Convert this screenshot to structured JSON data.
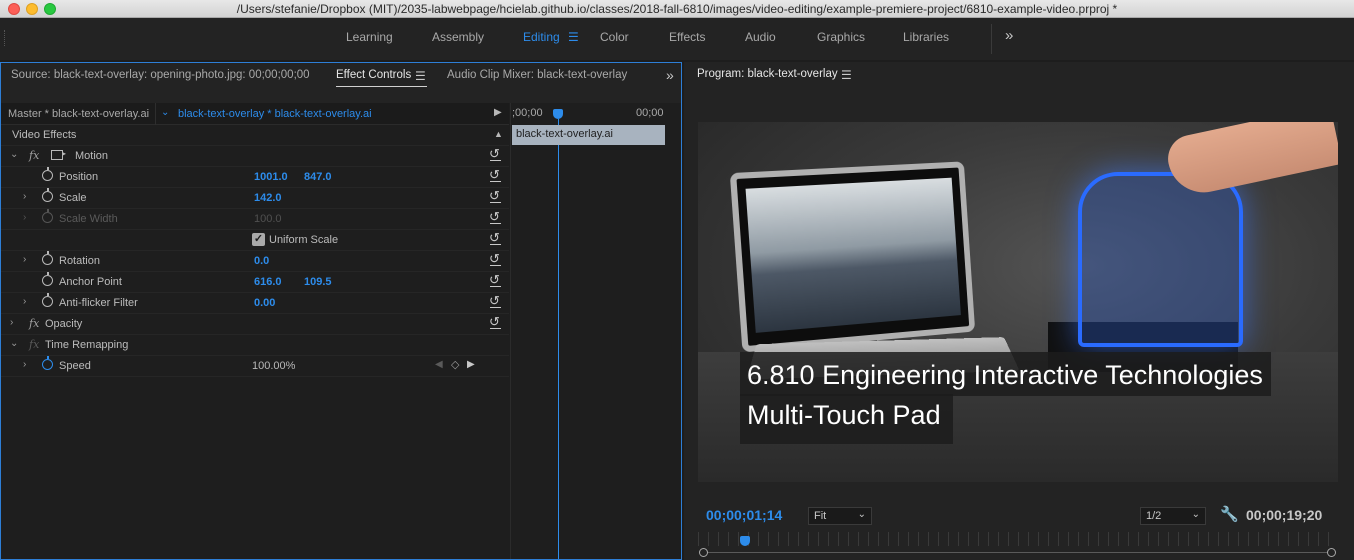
{
  "window": {
    "title": "/Users/stefanie/Dropbox (MIT)/2035-labwebpage/hcielab.github.io/classes/2018-fall-6810/images/video-editing/example-premiere-project/6810-example-video.prproj *"
  },
  "workspaces": {
    "tabs": [
      "Learning",
      "Assembly",
      "Editing",
      "Color",
      "Effects",
      "Audio",
      "Graphics",
      "Libraries"
    ],
    "active": "Editing",
    "more": "»"
  },
  "left_panel": {
    "tabs": {
      "source": "Source: black-text-overlay: opening-photo.jpg: 00;00;00;00",
      "effect_controls": "Effect Controls",
      "audio_mixer": "Audio Clip Mixer: black-text-overlay"
    },
    "master": {
      "left": "Master * black-text-overlay.ai",
      "right": "black-text-overlay * black-text-overlay.ai"
    },
    "section": "Video Effects",
    "effects": {
      "motion": "Motion",
      "position": {
        "label": "Position",
        "x": "1001.0",
        "y": "847.0"
      },
      "scale": {
        "label": "Scale",
        "value": "142.0"
      },
      "scale_width": {
        "label": "Scale Width",
        "value": "100.0"
      },
      "uniform_scale": {
        "label": "Uniform Scale",
        "checked": true
      },
      "rotation": {
        "label": "Rotation",
        "value": "0.0"
      },
      "anchor_point": {
        "label": "Anchor Point",
        "x": "616.0",
        "y": "109.5"
      },
      "anti_flicker": {
        "label": "Anti-flicker Filter",
        "value": "0.00"
      },
      "opacity": "Opacity",
      "time_remapping": "Time Remapping",
      "speed": {
        "label": "Speed",
        "value": "100.00%"
      }
    },
    "mini_timeline": {
      "start": ";00;00",
      "end": "00;00",
      "clip": "black-text-overlay.ai"
    }
  },
  "program": {
    "title": "Program: black-text-overlay",
    "caption_line1": "6.810 Engineering Interactive Technologies",
    "caption_line2": "Multi-Touch Pad",
    "timecode": "00;00;01;14",
    "zoom": "Fit",
    "resolution": "1/2",
    "duration": "00;00;19;20"
  },
  "icons": {
    "menu": "☰",
    "fx": "fx",
    "twisty_right": "›",
    "twisty_down": "⌄",
    "play": "▶",
    "wrench": "🔧"
  }
}
